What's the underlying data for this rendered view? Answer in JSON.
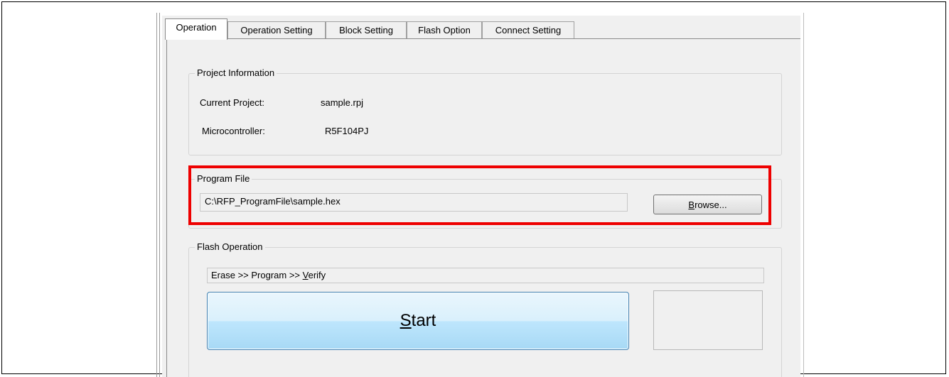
{
  "tabs": [
    {
      "label": "Operation",
      "active": true
    },
    {
      "label": "Operation Setting",
      "active": false
    },
    {
      "label": "Block Setting",
      "active": false
    },
    {
      "label": "Flash Option",
      "active": false
    },
    {
      "label": "Connect Setting",
      "active": false
    }
  ],
  "project_info": {
    "title": "Project Information",
    "current_project_label": "Current Project:",
    "current_project_value": "sample.rpj",
    "microcontroller_label": "Microcontroller:",
    "microcontroller_value": "R5F104PJ"
  },
  "program_file": {
    "title": "Program File",
    "path": "C:\\RFP_ProgramFile\\sample.hex",
    "browse_mnemonic": "B",
    "browse_rest": "rowse..."
  },
  "flash_operation": {
    "title": "Flash Operation",
    "sequence_prefix": "Erase >> Program >> ",
    "sequence_mnemonic": "V",
    "sequence_rest": "erify",
    "start_mnemonic": "S",
    "start_rest": "tart"
  },
  "colors": {
    "highlight": "#ee0000",
    "start_border": "#3c7fb1"
  }
}
